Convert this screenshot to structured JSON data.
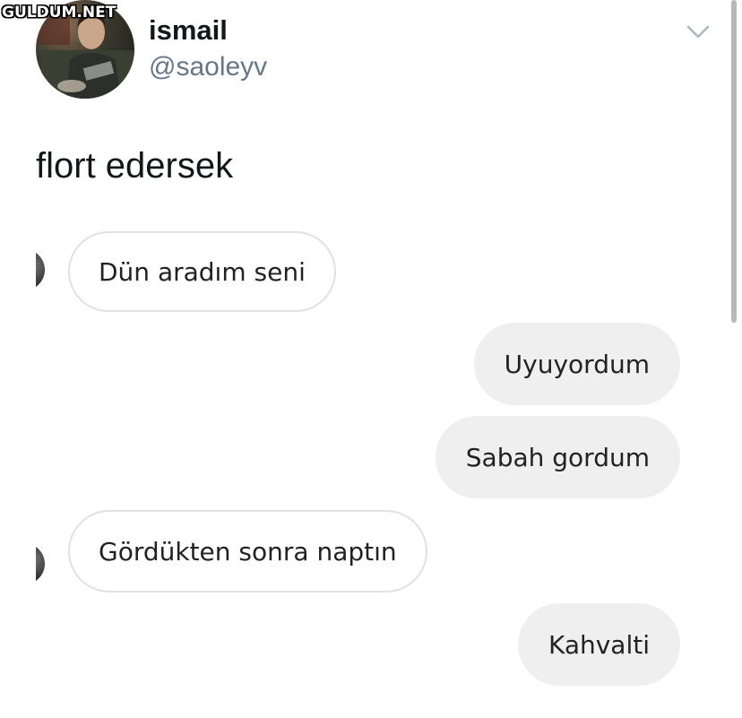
{
  "watermark": "GULDUM.NET",
  "tweet": {
    "display_name": "ismail",
    "handle": "@saoleyv",
    "text": "flort edersek",
    "menu_icon": "chevron-down-icon"
  },
  "chat": {
    "messages": [
      {
        "side": "incoming",
        "text": "Dün aradım seni"
      },
      {
        "side": "outgoing",
        "text": "Uyuyordum"
      },
      {
        "side": "outgoing",
        "text": "Sabah gordum"
      },
      {
        "side": "incoming",
        "text": "Gördükten sonra naptın"
      },
      {
        "side": "outgoing",
        "text": "Kahvalti"
      }
    ]
  },
  "colors": {
    "outgoing_bubble": "#efefef",
    "incoming_border": "#e1e1e1",
    "handle": "#657786"
  }
}
